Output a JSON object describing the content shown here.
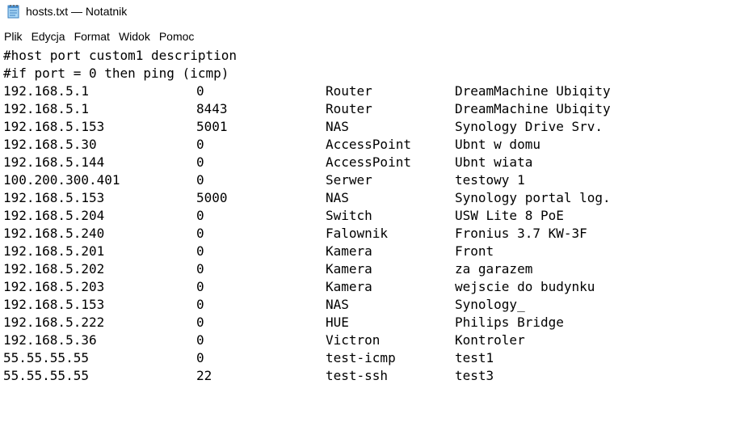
{
  "window": {
    "title": "hosts.txt — Notatnik"
  },
  "menu": [
    "Plik",
    "Edycja",
    "Format",
    "Widok",
    "Pomoc"
  ],
  "editor": {
    "comments": [
      "#host port custom1 description",
      "#if port = 0 then ping (icmp)"
    ],
    "rows": [
      [
        "192.168.5.1",
        "0",
        "Router",
        "DreamMachine Ubiqity"
      ],
      [
        "192.168.5.1",
        "8443",
        "Router",
        "DreamMachine Ubiqity"
      ],
      [
        "192.168.5.153",
        "5001",
        "NAS",
        "Synology Drive Srv."
      ],
      [
        "192.168.5.30",
        "0",
        "AccessPoint",
        "Ubnt w domu"
      ],
      [
        "192.168.5.144",
        "0",
        "AccessPoint",
        "Ubnt wiata"
      ],
      [
        "100.200.300.401",
        "0",
        "Serwer",
        "testowy 1"
      ],
      [
        "192.168.5.153",
        "5000",
        "NAS",
        "Synology portal log."
      ],
      [
        "192.168.5.204",
        "0",
        "Switch",
        "USW Lite 8 PoE"
      ],
      [
        "192.168.5.240",
        "0",
        "Falownik",
        "Fronius 3.7 KW-3F"
      ],
      [
        "192.168.5.201",
        "0",
        "Kamera",
        "Front"
      ],
      [
        "192.168.5.202",
        "0",
        "Kamera",
        "za garazem"
      ],
      [
        "192.168.5.203",
        "0",
        "Kamera",
        "wejscie do budynku"
      ],
      [
        "192.168.5.153",
        "0",
        "NAS",
        "Synology_"
      ],
      [
        "192.168.5.222",
        "0",
        "HUE",
        "Philips Bridge"
      ],
      [
        "192.168.5.36",
        "0",
        "Victron",
        "Kontroler"
      ],
      [
        "55.55.55.55",
        "0",
        "test-icmp",
        "test1"
      ],
      [
        "55.55.55.55",
        "22",
        "test-ssh",
        "test3"
      ]
    ]
  }
}
